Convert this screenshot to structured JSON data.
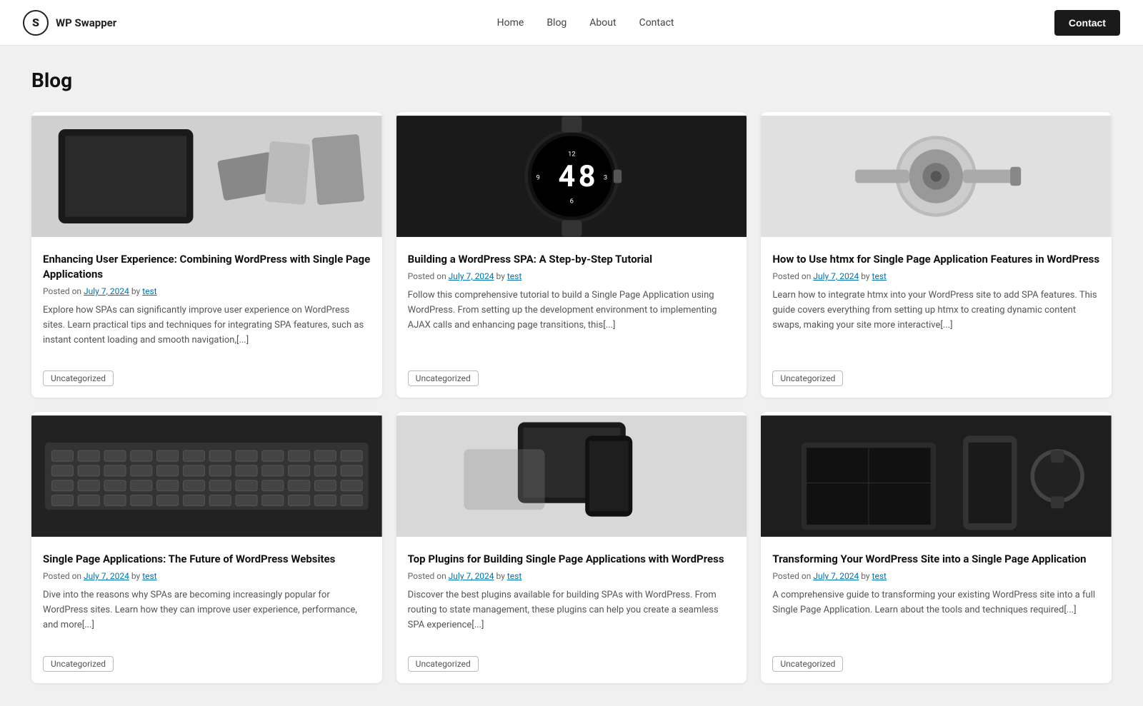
{
  "site": {
    "logo_icon": "S",
    "logo_name": "WP Swapper"
  },
  "nav": {
    "items": [
      {
        "label": "Home",
        "href": "#"
      },
      {
        "label": "Blog",
        "href": "#"
      },
      {
        "label": "About",
        "href": "#"
      },
      {
        "label": "Contact",
        "href": "#"
      }
    ],
    "cta_label": "Contact"
  },
  "page": {
    "title": "Blog"
  },
  "posts": [
    {
      "id": 1,
      "title": "Enhancing User Experience: Combining WordPress with Single Page Applications",
      "date": "July 7, 2024",
      "author": "test",
      "excerpt": "Explore how SPAs can significantly improve user experience on WordPress sites. Learn practical tips and techniques for integrating SPA features, such as instant content loading and smooth navigation,[...]",
      "tag": "Uncategorized",
      "img_type": "tablet"
    },
    {
      "id": 2,
      "title": "Building a WordPress SPA: A Step-by-Step Tutorial",
      "date": "July 7, 2024",
      "author": "test",
      "excerpt": "Follow this comprehensive tutorial to build a Single Page Application using WordPress. From setting up the development environment to implementing AJAX calls and enhancing page transitions, this[...]",
      "tag": "Uncategorized",
      "img_type": "watch"
    },
    {
      "id": 3,
      "title": "How to Use htmx for Single Page Application Features in WordPress",
      "date": "July 7, 2024",
      "author": "test",
      "excerpt": "Learn how to integrate htmx into your WordPress site to add SPA features. This guide covers everything from setting up htmx to creating dynamic content swaps, making your site more interactive[...]",
      "tag": "Uncategorized",
      "img_type": "speaker"
    },
    {
      "id": 4,
      "title": "Single Page Applications: The Future of WordPress Websites",
      "date": "July 7, 2024",
      "author": "test",
      "excerpt": "Dive into the reasons why SPAs are becoming increasingly popular for WordPress sites. Learn how they can improve user experience, performance, and more[...]",
      "tag": "Uncategorized",
      "img_type": "keyboard"
    },
    {
      "id": 5,
      "title": "Top Plugins for Building Single Page Applications with WordPress",
      "date": "July 7, 2024",
      "author": "test",
      "excerpt": "Discover the best plugins available for building SPAs with WordPress. From routing to state management, these plugins can help you create a seamless SPA experience[...]",
      "tag": "Uncategorized",
      "img_type": "phone"
    },
    {
      "id": 6,
      "title": "Transforming Your WordPress Site into a Single Page Application",
      "date": "July 7, 2024",
      "author": "test",
      "excerpt": "A comprehensive guide to transforming your existing WordPress site into a full Single Page Application. Learn about the tools and techniques required[...]",
      "tag": "Uncategorized",
      "img_type": "devices"
    }
  ]
}
